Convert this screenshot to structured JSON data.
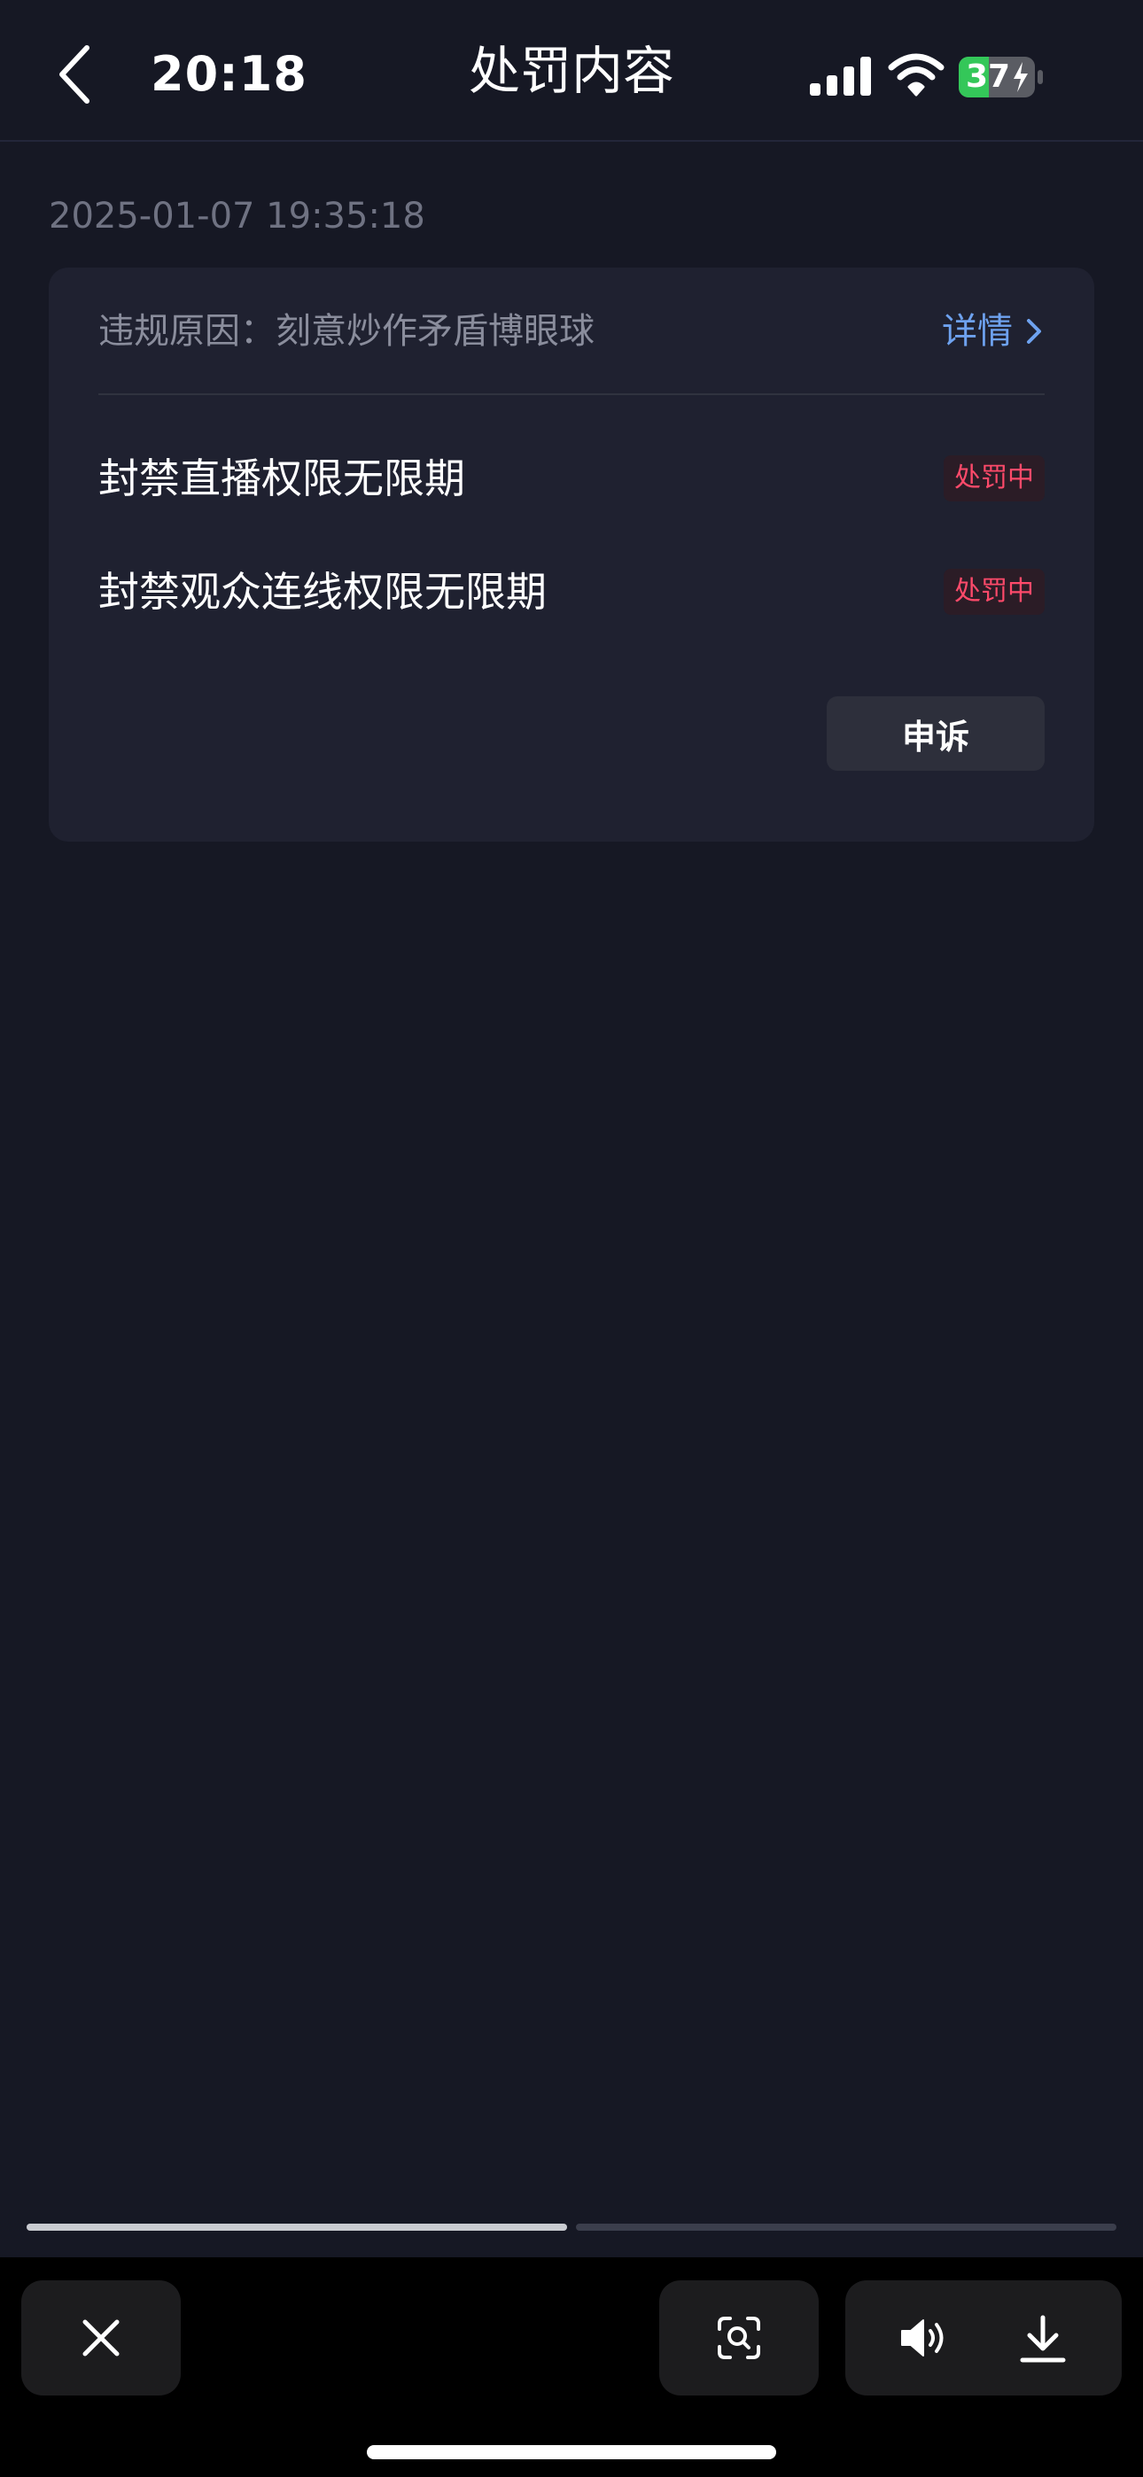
{
  "status_bar": {
    "time": "20:18",
    "battery_level": "37"
  },
  "header": {
    "title": "处罚内容"
  },
  "record": {
    "timestamp": "2025-01-07 19:35:18",
    "reason": "违规原因：刻意炒作矛盾博眼球",
    "detail_label": "详情",
    "penalties": [
      {
        "text": "封禁直播权限无限期",
        "status": "处罚中"
      },
      {
        "text": "封禁观众连线权限无限期",
        "status": "处罚中"
      }
    ],
    "appeal_label": "申诉"
  },
  "story_progress": {
    "segments": [
      {
        "fill": 1.0
      },
      {
        "fill": 0.0
      }
    ]
  },
  "colors": {
    "background": "#161824",
    "card": "#1f2130",
    "accent_link": "#6ea2ef",
    "status_red": "#ff4a6a"
  },
  "dock": {
    "buttons": [
      "close-icon",
      "visual-search-icon",
      "speaker-icon",
      "download-icon"
    ]
  }
}
